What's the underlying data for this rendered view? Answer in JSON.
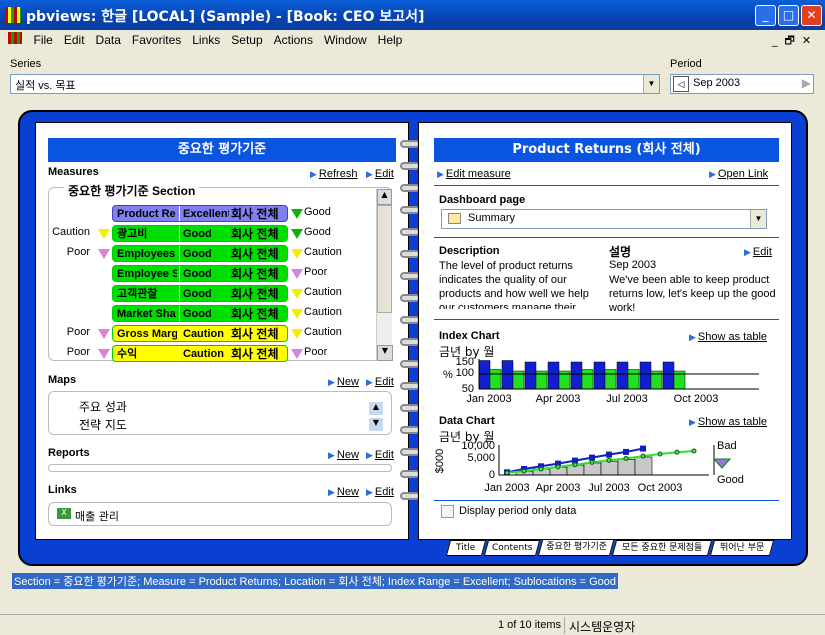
{
  "window": {
    "title": "pbviews: 한글 [LOCAL] (Sample) - [Book: CEO 보고서]"
  },
  "menu": [
    "File",
    "Edit",
    "Data",
    "Favorites",
    "Links",
    "Setup",
    "Actions",
    "Window",
    "Help"
  ],
  "series": {
    "label": "Series",
    "value": "실적 vs. 목표"
  },
  "period": {
    "label": "Period",
    "value": "Sep 2003"
  },
  "left": {
    "title": "중요한 평가기준",
    "measures": {
      "label": "Measures",
      "refresh": "Refresh",
      "edit": "Edit",
      "section": "중요한 평가기준 Section",
      "rows": [
        {
          "left": "",
          "left_color": "",
          "name": "Product Re",
          "range": "Excellent",
          "loc": "회사 전체",
          "color": "#8080f0",
          "right": "Good",
          "right_color": "#10b010"
        },
        {
          "left": "Caution",
          "left_color": "#f0f000",
          "name": "광고비",
          "range": "Good",
          "loc": "회사 전체",
          "color": "#00e000",
          "right": "Good",
          "right_color": "#10b010"
        },
        {
          "left": "Poor",
          "left_color": "#e080e0",
          "name": "Employees",
          "range": "Good",
          "loc": "회사 전체",
          "color": "#00e000",
          "right": "Caution",
          "right_color": "#f0f000"
        },
        {
          "left": "",
          "left_color": "",
          "name": "Employee S",
          "range": "Good",
          "loc": "회사 전체",
          "color": "#00e000",
          "right": "Poor",
          "right_color": "#e080e0"
        },
        {
          "left": "",
          "left_color": "",
          "name": "고객관찰",
          "range": "Good",
          "loc": "회사 전체",
          "color": "#00e000",
          "right": "Caution",
          "right_color": "#f0f000"
        },
        {
          "left": "",
          "left_color": "",
          "name": "Market Sha",
          "range": "Good",
          "loc": "회사 전체",
          "color": "#00e000",
          "right": "Caution",
          "right_color": "#f0f000"
        },
        {
          "left": "Poor",
          "left_color": "#e080e0",
          "name": "Gross Marg",
          "range": "Caution",
          "loc": "회사 전체",
          "color": "#ffff00",
          "right": "Caution",
          "right_color": "#f0f000"
        },
        {
          "left": "Poor",
          "left_color": "#e080e0",
          "name": "수익",
          "range": "Caution",
          "loc": "회사 전체",
          "color": "#ffff00",
          "right": "Poor",
          "right_color": "#e080e0"
        }
      ]
    },
    "maps": {
      "label": "Maps",
      "new": "New",
      "edit": "Edit",
      "items": [
        "주요 성과",
        "전략 지도"
      ]
    },
    "reports": {
      "label": "Reports",
      "new": "New",
      "edit": "Edit"
    },
    "links": {
      "label": "Links",
      "new": "New",
      "edit": "Edit",
      "items": [
        "매출 관리"
      ]
    }
  },
  "right": {
    "title": "Product Returns (회사 전체)",
    "edit_measure": "Edit measure",
    "open_link": "Open Link",
    "dashboard": {
      "label": "Dashboard page",
      "value": "Summary"
    },
    "description": {
      "label": "Description",
      "text": "The level of product returns indicates the quality of our products and how well we help our customers manage their"
    },
    "korean_desc": {
      "label": "설명",
      "edit": "Edit",
      "date": "Sep 2003",
      "text": "We've been able to keep product returns low, let's keep up the good work!"
    },
    "index_chart": {
      "label": "Index Chart",
      "subtitle": "금년 by 월",
      "show_table": "Show as table",
      "ylabel": "%"
    },
    "data_chart": {
      "label": "Data Chart",
      "subtitle": "금년 by 월",
      "show_table": "Show as table",
      "ylabel": "$000",
      "bad": "Bad",
      "good": "Good"
    },
    "period_only": "Display period only data"
  },
  "chart_data": [
    {
      "type": "bar",
      "title": "Index Chart",
      "ylabel": "%",
      "ylim": [
        50,
        150
      ],
      "yticks": [
        "150",
        "100",
        "50"
      ],
      "xticks": [
        "Jan 2003",
        "Apr 2003",
        "Jul 2003",
        "Oct 2003"
      ],
      "reference": 100,
      "categories": [
        "Jan",
        "Feb",
        "Mar",
        "Apr",
        "May",
        "Jun",
        "Jul",
        "Aug",
        "Sep"
      ],
      "series": [
        {
          "values": [
            145,
            145,
            140,
            140,
            140,
            140,
            140,
            140,
            140
          ],
          "color": "#1020d0"
        },
        {
          "values": [
            115,
            110,
            110,
            110,
            115,
            115,
            115,
            110,
            110
          ],
          "color": "#20e020"
        }
      ]
    },
    {
      "type": "line",
      "title": "Data Chart",
      "ylabel": "$000",
      "ylim": [
        0,
        10000
      ],
      "yticks": [
        "10,000",
        "5,000",
        "0"
      ],
      "xticks": [
        "Jan 2003",
        "Apr 2003",
        "Jul 2003",
        "Oct 2003"
      ],
      "categories": [
        "Jan",
        "Feb",
        "Mar",
        "Apr",
        "May",
        "Jun",
        "Jul",
        "Aug",
        "Sep",
        "Oct",
        "Nov",
        "Dec"
      ],
      "bars": [
        null,
        1200,
        2000,
        2600,
        3300,
        4000,
        4600,
        5200,
        6000
      ],
      "series": [
        {
          "values": [
            900,
            2000,
            2900,
            3800,
            4800,
            5800,
            6800,
            7700,
            8800
          ],
          "color": "#1020c0"
        },
        {
          "values": [
            700,
            1300,
            2000,
            2700,
            3400,
            4200,
            4900,
            5500,
            6300,
            7000,
            7600,
            8000
          ],
          "color": "#30e030"
        }
      ]
    }
  ],
  "tabs": [
    "Title",
    "Contents",
    "중요한 평가기준",
    "모든 중요한 문제점들",
    "뛰어난 부문"
  ],
  "status_line": "Section = 중요한 평가기준; Measure = Product Returns; Location = 회사 전체; Index Range = Excellent; Sublocations = Good",
  "statusbar": {
    "items": "1 of 10 items",
    "user": "시스템운영자"
  }
}
